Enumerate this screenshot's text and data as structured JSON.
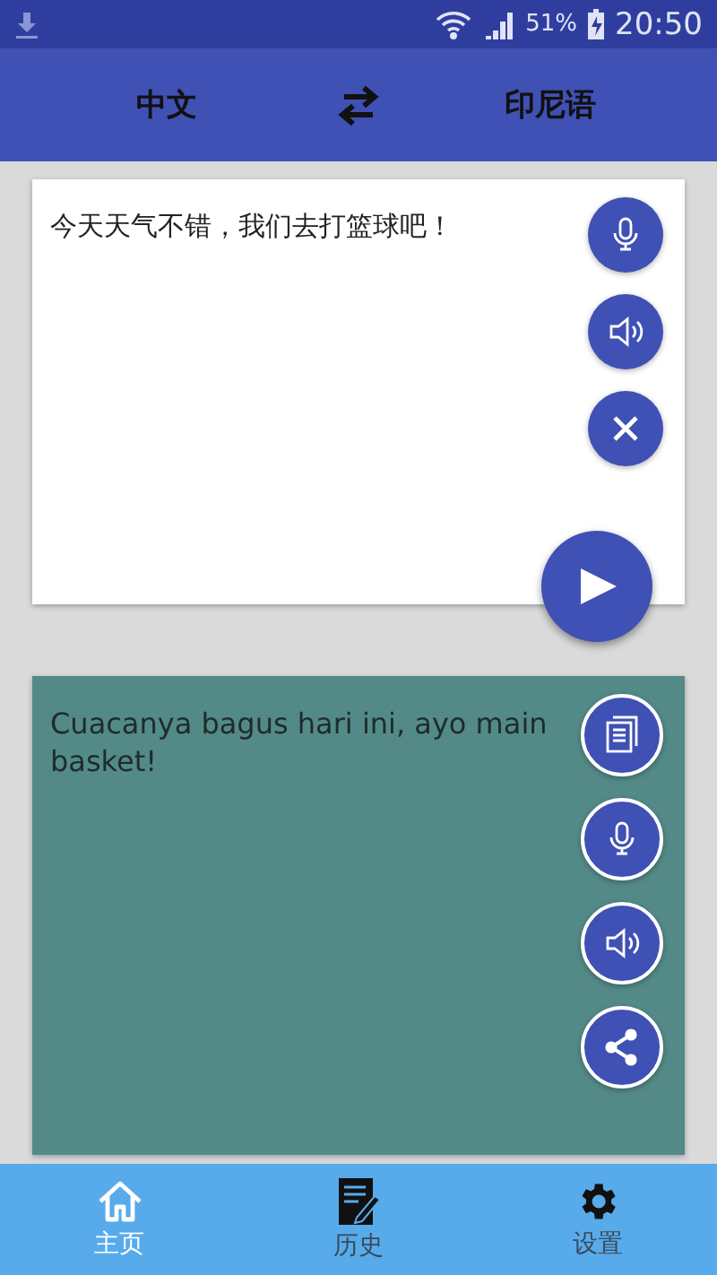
{
  "status_bar": {
    "battery": "51%",
    "time": "20:50"
  },
  "header": {
    "source_language": "中文",
    "target_language": "印尼语"
  },
  "input": {
    "text": "今天天气不错，我们去打篮球吧！"
  },
  "output": {
    "text": "Cuacanya bagus hari ini, ayo main basket!"
  },
  "nav": [
    {
      "label": "主页",
      "selected": true,
      "kind": "home"
    },
    {
      "label": "历史",
      "selected": false,
      "kind": "history"
    },
    {
      "label": "设置",
      "selected": false,
      "kind": "settings"
    }
  ]
}
